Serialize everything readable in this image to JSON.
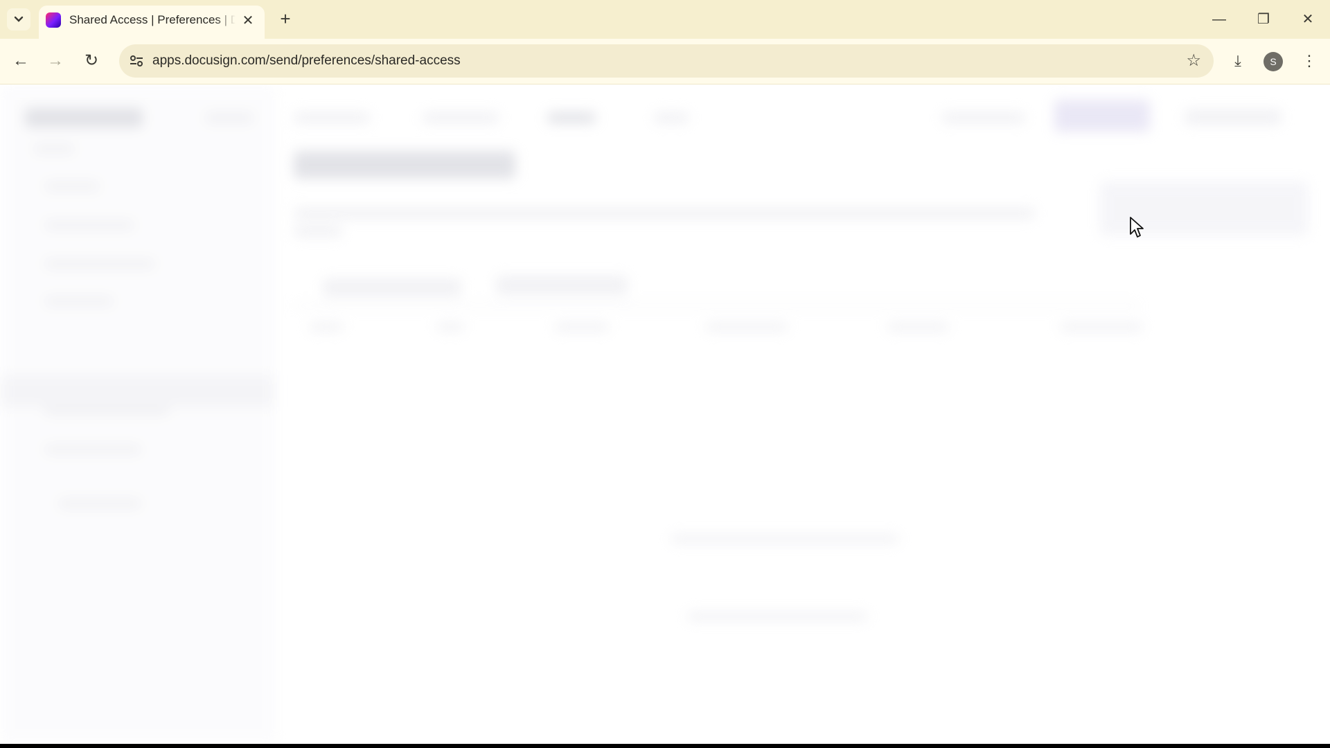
{
  "browser": {
    "tab": {
      "title": "Shared Access | Preferences | DocuSign",
      "close_glyph": "✕",
      "favicon": "docusign-logo-icon"
    },
    "new_tab_glyph": "+",
    "window_controls": {
      "minimize": "—",
      "restore": "❐",
      "close": "✕"
    },
    "nav": {
      "back": "←",
      "forward": "→",
      "reload": "↻"
    },
    "url": "apps.docusign.com/send/preferences/shared-access",
    "bookmark_glyph": "☆",
    "download_glyph": "⤓",
    "profile_initial": "S",
    "menu_glyph": "⋮",
    "colors": {
      "tabbar": "#f6efcf",
      "toolbar": "#fffbea",
      "omnibox": "#f3ecd0"
    }
  },
  "page": {
    "state": "blurred-loading"
  }
}
